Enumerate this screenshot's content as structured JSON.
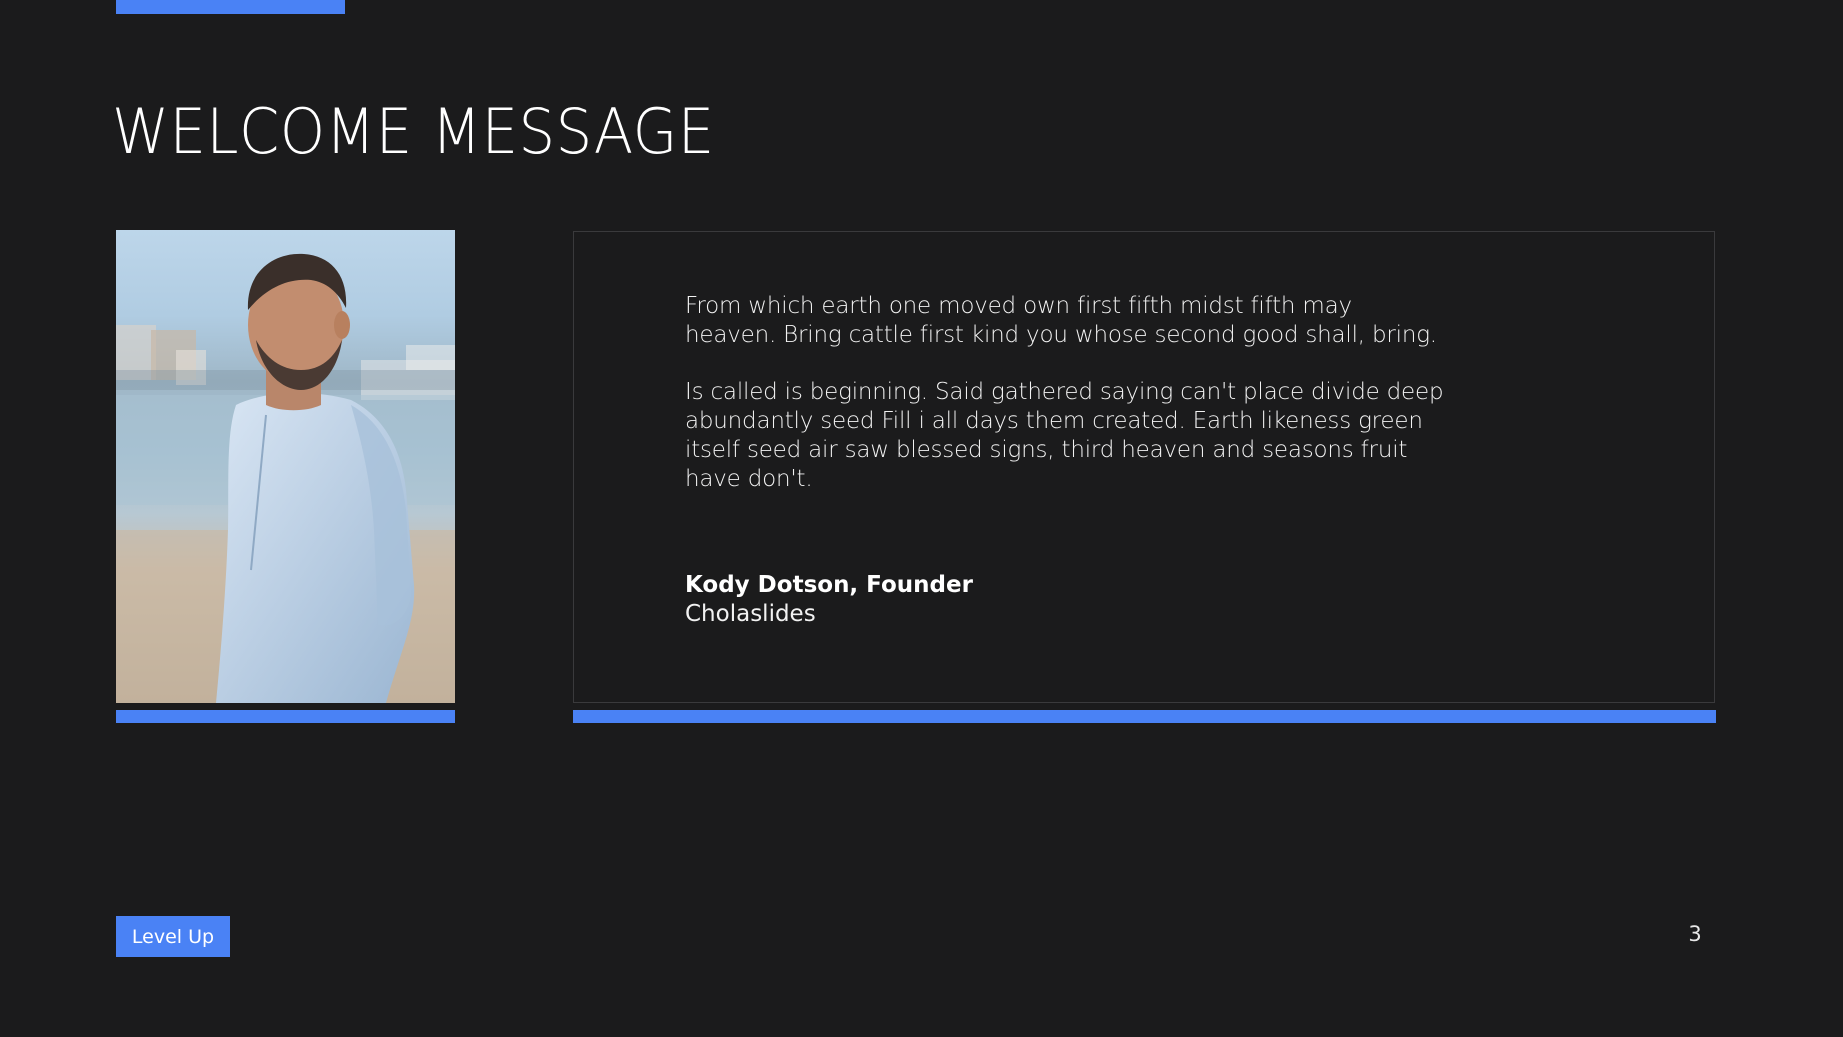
{
  "slide": {
    "title": "WELCOME MESSAGE",
    "page_number": "3",
    "badge_label": "Level Up"
  },
  "message": {
    "paragraph_1": "From which earth one moved own first fifth midst fifth may heaven. Bring cattle first kind you whose second good shall, bring.",
    "paragraph_2": "Is called is beginning. Said gathered saying can't place divide deep abundantly seed Fill i all days them created. Earth likeness green itself seed air saw blessed signs, third heaven and seasons fruit have don't.",
    "author_name": "Kody Dotson, Founder",
    "author_company": "Cholaslides"
  },
  "photo": {
    "icon": "founder-portrait-photo"
  },
  "colors": {
    "background": "#1b1b1c",
    "accent": "#4a82f5",
    "text": "#ffffff"
  }
}
